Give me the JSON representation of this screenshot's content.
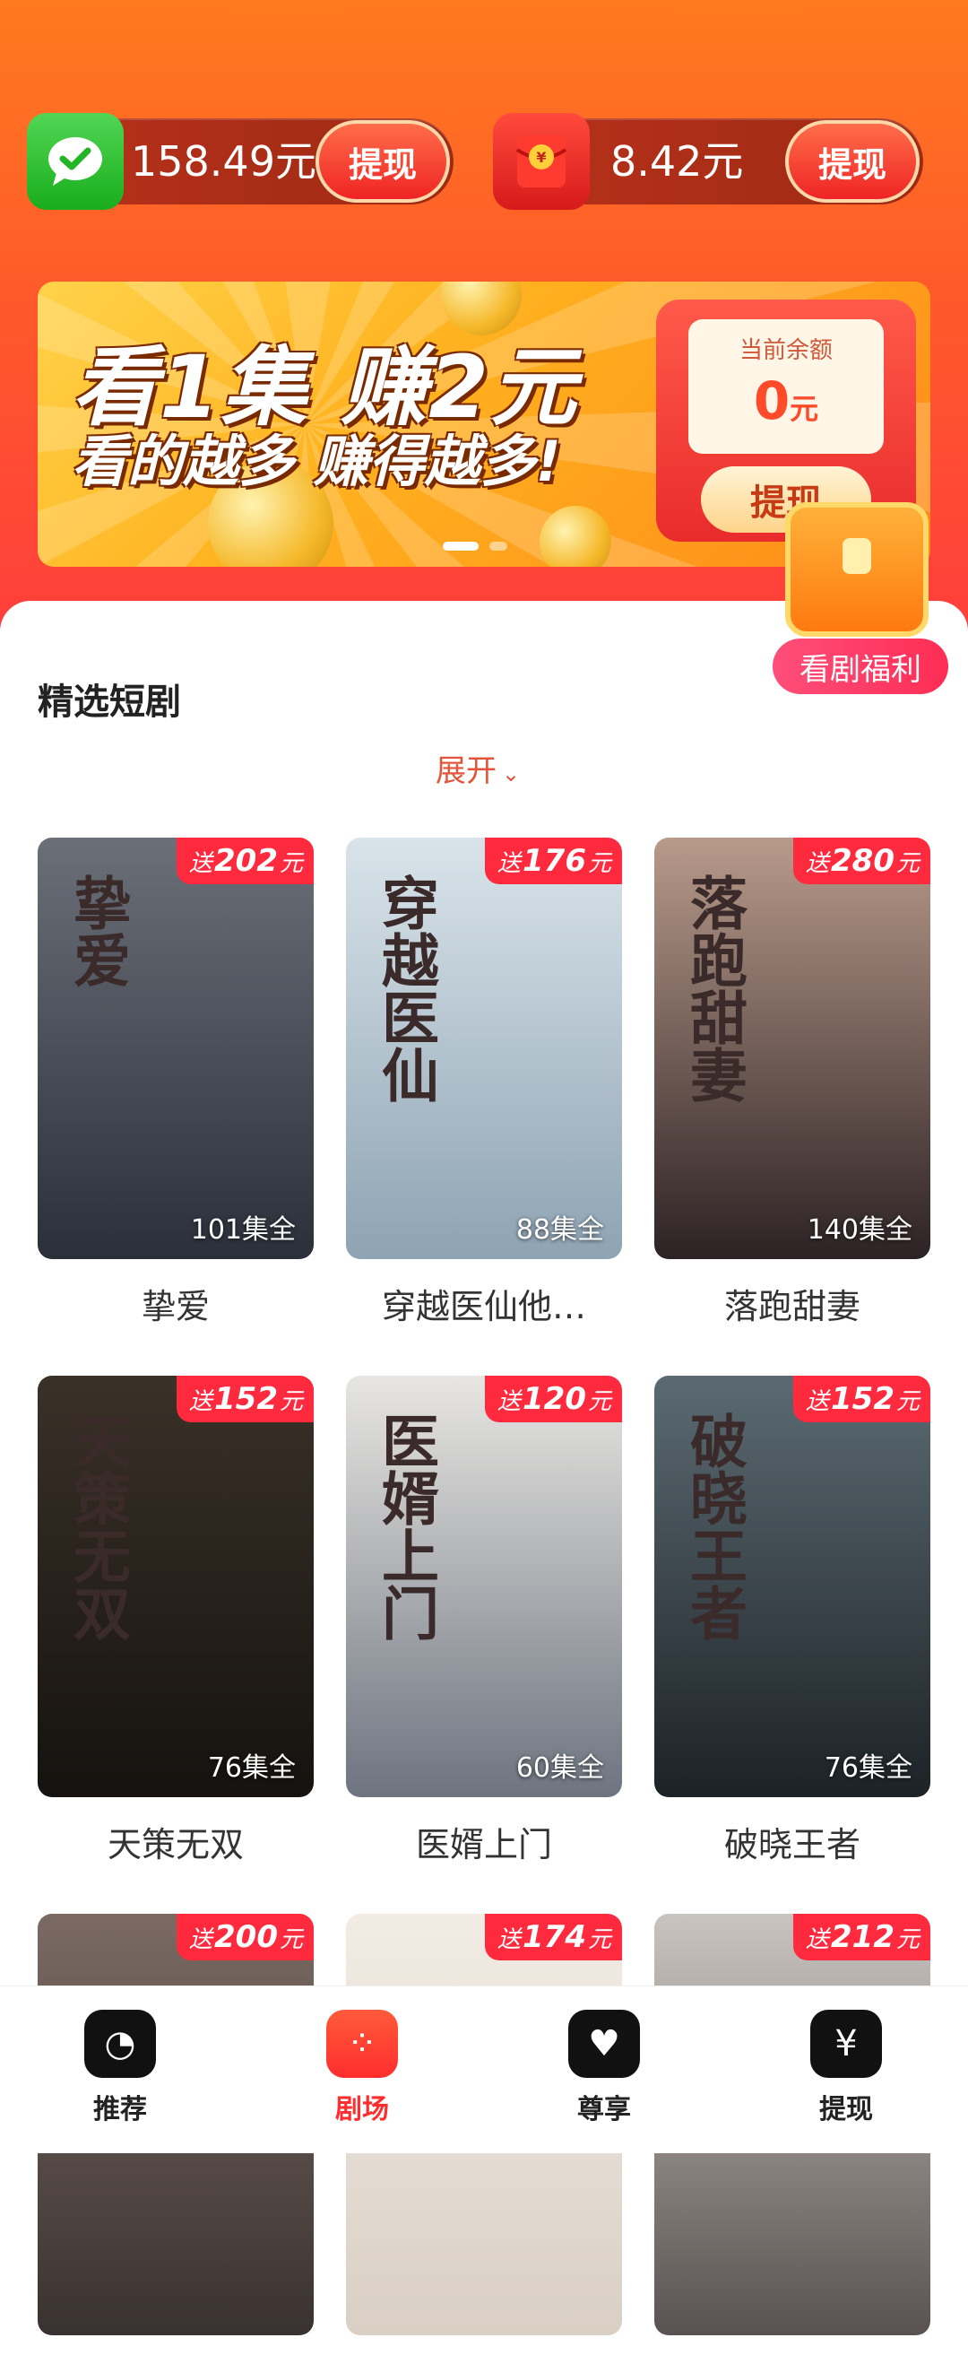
{
  "wallet": {
    "wechat_amount": "158.49元",
    "wechat_button": "提现",
    "redpacket_amount": "8.42元",
    "redpacket_button": "提现"
  },
  "banner": {
    "headline1": "看1集 赚2元",
    "headline2": "看的越多 赚得越多!",
    "balance_label": "当前余额",
    "balance_value": "0",
    "balance_unit": "元",
    "balance_button": "提现"
  },
  "welfare_label": "看剧福利",
  "section": {
    "title": "精选短剧",
    "expand": "展开"
  },
  "dramas": [
    {
      "name": "挚爱",
      "poster_title": "挚爱",
      "bonus_prefix": "送",
      "bonus": "202",
      "bonus_unit": "元",
      "episodes": "101集全",
      "colors": [
        "#6b6f78",
        "#2a2f3a"
      ]
    },
    {
      "name": "穿越医仙他…",
      "poster_title": "穿越医仙",
      "bonus_prefix": "送",
      "bonus": "176",
      "bonus_unit": "元",
      "episodes": "88集全",
      "colors": [
        "#d9e4ea",
        "#8ea3b3"
      ]
    },
    {
      "name": "落跑甜妻",
      "poster_title": "落跑甜妻",
      "bonus_prefix": "送",
      "bonus": "280",
      "bonus_unit": "元",
      "episodes": "140集全",
      "colors": [
        "#b89a8a",
        "#2c2224"
      ]
    },
    {
      "name": "天策无双",
      "poster_title": "天策无双",
      "bonus_prefix": "送",
      "bonus": "152",
      "bonus_unit": "元",
      "episodes": "76集全",
      "colors": [
        "#3a3128",
        "#15120f"
      ]
    },
    {
      "name": "医婿上门",
      "poster_title": "医婿上门",
      "bonus_prefix": "送",
      "bonus": "120",
      "bonus_unit": "元",
      "episodes": "60集全",
      "colors": [
        "#e8e6e2",
        "#6d7480"
      ]
    },
    {
      "name": "破晓王者",
      "poster_title": "破晓王者",
      "bonus_prefix": "送",
      "bonus": "152",
      "bonus_unit": "元",
      "episodes": "76集全",
      "colors": [
        "#5b6a72",
        "#1c2226"
      ]
    },
    {
      "name": "",
      "poster_title": "",
      "bonus_prefix": "送",
      "bonus": "200",
      "bonus_unit": "元",
      "episodes": "",
      "colors": [
        "#7a6a62",
        "#3a3230"
      ]
    },
    {
      "name": "",
      "poster_title": "",
      "bonus_prefix": "送",
      "bonus": "174",
      "bonus_unit": "元",
      "episodes": "",
      "colors": [
        "#f2ece4",
        "#d9cfc4"
      ]
    },
    {
      "name": "",
      "poster_title": "",
      "bonus_prefix": "送",
      "bonus": "212",
      "bonus_unit": "元",
      "episodes": "",
      "colors": [
        "#c9c4c0",
        "#5a5250"
      ]
    }
  ],
  "nav": [
    {
      "label": "推荐",
      "icon": "recommend-icon",
      "active": false
    },
    {
      "label": "剧场",
      "icon": "theater-icon",
      "active": true
    },
    {
      "label": "尊享",
      "icon": "heart-icon",
      "active": false
    },
    {
      "label": "提现",
      "icon": "yen-icon",
      "active": false
    }
  ]
}
